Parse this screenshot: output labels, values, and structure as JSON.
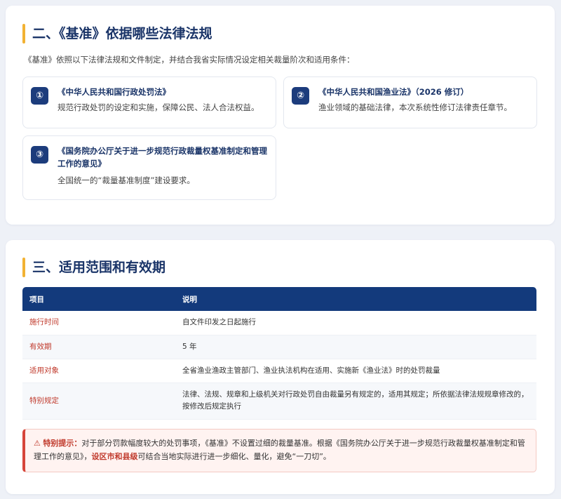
{
  "section2": {
    "title": "二、《基准》依据哪些法律法规",
    "intro": "《基准》依照以下法律法规和文件制定，并结合我省实际情况设定相关裁量阶次和适用条件：",
    "laws": [
      {
        "num": "①",
        "name": "《中华人民共和国行政处罚法》",
        "desc": "规范行政处罚的设定和实施，保障公民、法人合法权益。"
      },
      {
        "num": "②",
        "name": "《中华人民共和国渔业法》（2026 修订）",
        "desc": "渔业领域的基础法律，本次系统性修订法律责任章节。"
      },
      {
        "num": "③",
        "name": "《国务院办公厅关于进一步规范行政裁量权基准制定和管理工作的意见》",
        "desc": "全国统一的“裁量基准制度”建设要求。"
      }
    ]
  },
  "section3": {
    "title": "三、适用范围和有效期",
    "headers": {
      "item": "项目",
      "desc": "说明"
    },
    "rows": [
      {
        "item": "施行时间",
        "desc": "自文件印发之日起施行"
      },
      {
        "item": "有效期",
        "desc": "5 年"
      },
      {
        "item": "适用对象",
        "desc": "全省渔业渔政主管部门、渔业执法机构在适用、实施新《渔业法》时的处罚裁量"
      },
      {
        "item": "特别规定",
        "desc": "法律、法规、规章和上级机关对行政处罚自由裁量另有规定的，适用其规定；所依据法律法规规章修改的，按修改后规定执行"
      }
    ],
    "notice": {
      "icon": "⚠",
      "label": "特别提示：",
      "text_a": "对于部分罚款幅度较大的处罚事项，《基准》不设置过细的裁量基准。根据《国务院办公厅关于进一步规范行政裁量权基准制定和管理工作的意见》，",
      "highlight": "设区市和县级",
      "text_b": "可结合当地实际进行进一步细化、量化，避免“一刀切”。"
    }
  },
  "colors": {
    "accent_bar": "#f2b233",
    "title": "#1a3468",
    "table_header": "#133a7c",
    "warn": "#c0392b"
  }
}
